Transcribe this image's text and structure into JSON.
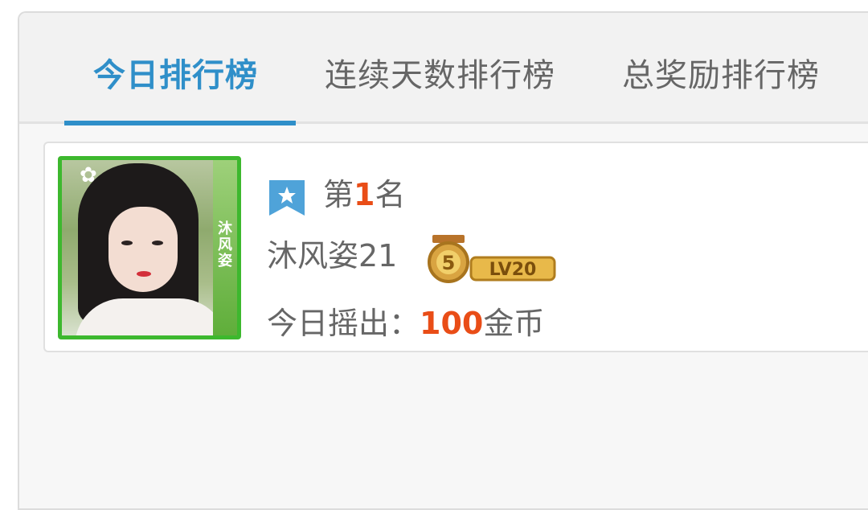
{
  "tabs": [
    {
      "label": "今日排行榜",
      "active": true
    },
    {
      "label": "连续天数排行榜",
      "active": false
    },
    {
      "label": "总奖励排行榜",
      "active": false
    }
  ],
  "entry": {
    "rank_prefix": "第",
    "rank_number": "1",
    "rank_suffix": "名",
    "username": "沐风姿21",
    "avatar_side_text": "沐风姿",
    "level_number": "5",
    "level_label": "LV20",
    "earn_label": "今日摇出：",
    "earn_amount": "100",
    "earn_unit": "金币"
  },
  "colors": {
    "accent": "#2f8fc9",
    "highlight": "#e94d17",
    "avatar_frame": "#3db82e"
  }
}
